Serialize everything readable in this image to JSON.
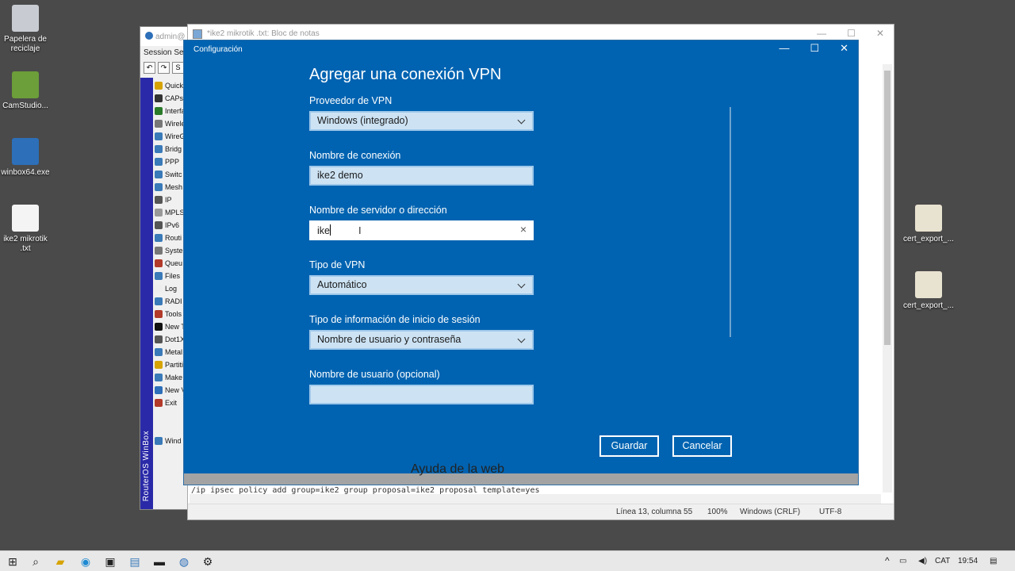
{
  "desktop": {
    "icons_left": [
      {
        "label": "Papelera de reciclaje",
        "icon": "recycle-bin-icon",
        "color": "#c8ccd2"
      },
      {
        "label": "CamStudio...",
        "icon": "camstudio-icon",
        "color": "#6c9e3a"
      },
      {
        "label": "winbox64.exe",
        "icon": "winbox-icon",
        "color": "#2d6fb8"
      },
      {
        "label": "ike2 mikrotik .txt",
        "icon": "text-file-icon",
        "color": "#f4f4f4"
      }
    ],
    "icons_right": [
      {
        "label": "cert_export_...",
        "icon": "certificate-icon",
        "color": "#e8e2d0"
      },
      {
        "label": "cert_export_...",
        "icon": "key-certificate-icon",
        "color": "#e8e2d0"
      }
    ]
  },
  "winbox": {
    "title": "admin@",
    "menu": "Session  Se",
    "toolbar": [
      "↶",
      "↷",
      "S"
    ],
    "side_label": "RouterOS WinBox",
    "items": [
      {
        "label": "Quick",
        "color": "#d6a300"
      },
      {
        "label": "CAPs",
        "color": "#333"
      },
      {
        "label": "Interfa",
        "color": "#2a7a2a"
      },
      {
        "label": "Wirele",
        "color": "#777"
      },
      {
        "label": "WireG",
        "color": "#3a7ab8"
      },
      {
        "label": "Bridg",
        "color": "#3a7ab8"
      },
      {
        "label": "PPP",
        "color": "#3a7ab8"
      },
      {
        "label": "Switc",
        "color": "#3a7ab8"
      },
      {
        "label": "Mesh",
        "color": "#3a7ab8"
      },
      {
        "label": "IP",
        "color": "#555"
      },
      {
        "label": "MPLS",
        "color": "#999"
      },
      {
        "label": "IPv6",
        "color": "#555"
      },
      {
        "label": "Routi",
        "color": "#3a7ab8"
      },
      {
        "label": "Syste",
        "color": "#777"
      },
      {
        "label": "Queu",
        "color": "#b23a2a"
      },
      {
        "label": "Files",
        "color": "#3a7ab8"
      },
      {
        "label": "Log",
        "color": "#eee"
      },
      {
        "label": "RADI",
        "color": "#3a7ab8"
      },
      {
        "label": "Tools",
        "color": "#b23a2a"
      },
      {
        "label": "New T",
        "color": "#111"
      },
      {
        "label": "Dot1X",
        "color": "#555"
      },
      {
        "label": "Metal",
        "color": "#3a7ab8"
      },
      {
        "label": "Partiti",
        "color": "#d6a300"
      },
      {
        "label": "Make",
        "color": "#3a7ab8"
      },
      {
        "label": "New V",
        "color": "#2d6fb8"
      },
      {
        "label": "Exit",
        "color": "#b23a2a"
      },
      {
        "label": "",
        "color": "#f0f0f0"
      },
      {
        "label": "",
        "color": "#f0f0f0"
      },
      {
        "label": "Wind",
        "color": "#3a7ab8"
      }
    ]
  },
  "notepad": {
    "title": "*ike2 mikrotik .txt: Bloc de notas",
    "text_line": "/ip ipsec policy add group=ike2 group proposal=ike2 proposal template=yes",
    "status": {
      "position": "Línea 13, columna 55",
      "zoom": "100%",
      "line_endings": "Windows (CRLF)",
      "encoding": "UTF-8"
    }
  },
  "settings": {
    "window_title": "Configuración",
    "heading": "Agregar una conexión VPN",
    "fields": {
      "provider": {
        "label": "Proveedor de VPN",
        "value": "Windows (integrado)"
      },
      "connection_name": {
        "label": "Nombre de conexión",
        "value": "ike2 demo"
      },
      "server": {
        "label": "Nombre de servidor o dirección",
        "value": "ike"
      },
      "vpn_type": {
        "label": "Tipo de VPN",
        "value": "Automático"
      },
      "signin_type": {
        "label": "Tipo de información de inicio de sesión",
        "value": "Nombre de usuario y contraseña"
      },
      "username": {
        "label": "Nombre de usuario (opcional)",
        "value": ""
      }
    },
    "save_label": "Guardar",
    "cancel_label": "Cancelar",
    "background_text": "Ayuda de la web"
  },
  "taskbar": {
    "language": "CAT",
    "time": "19:54"
  },
  "colors": {
    "dialog_bg": "#0063b1",
    "field_bg": "#cde3f4",
    "winbox_side": "#2a2aa8"
  }
}
